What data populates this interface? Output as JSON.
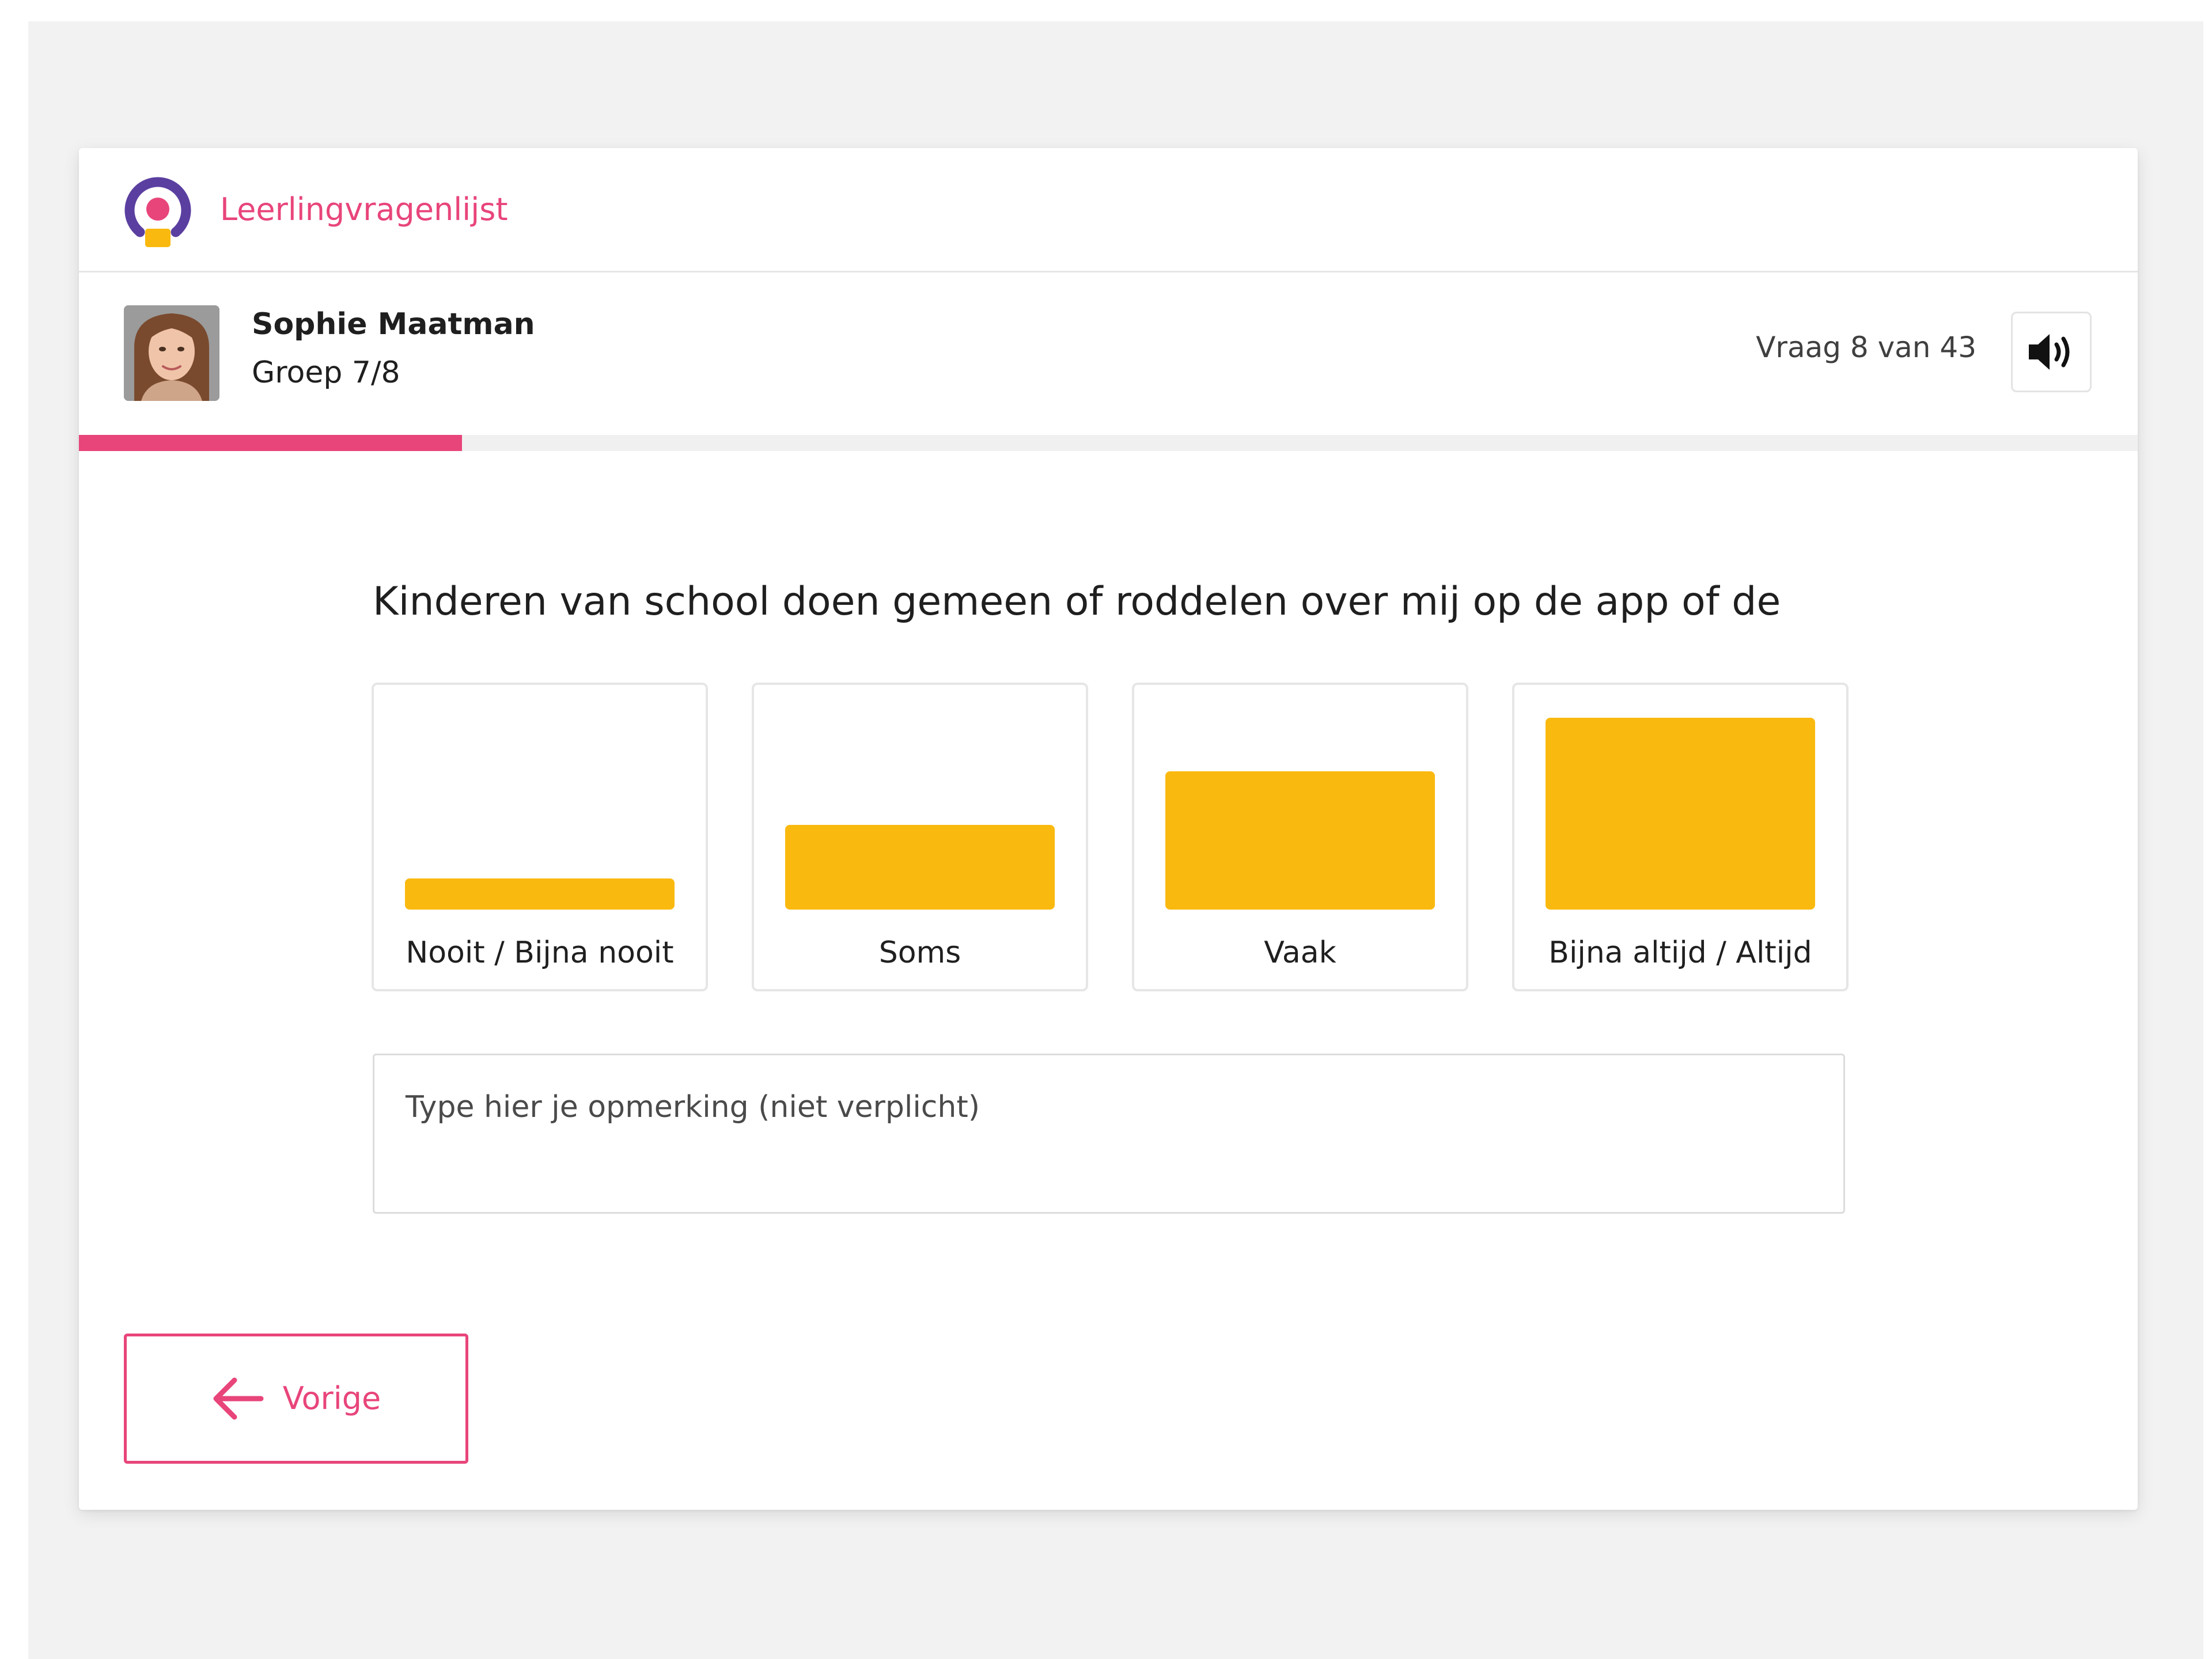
{
  "colors": {
    "accent": "#e8457a",
    "option_fill": "#fab90e",
    "logo_ring": "#5b3fa0",
    "logo_dot": "#e8457a",
    "logo_base": "#fab90e"
  },
  "header": {
    "app_title": "Leerlingvragenlijst",
    "logo_icon": "survey-logo-icon"
  },
  "student": {
    "name": "Sophie Maatman",
    "group": "Groep 7/8",
    "avatar_icon": "student-photo"
  },
  "progress": {
    "counter_text": "Vraag 8 van 43",
    "fraction": 0.186,
    "sound_icon": "speaker-icon"
  },
  "question": {
    "text": "Kinderen van school doen gemeen of roddelen over mij op de app of de"
  },
  "options": [
    {
      "label": "Nooit / Bijna nooit",
      "level": 1
    },
    {
      "label": "Soms",
      "level": 2
    },
    {
      "label": "Vaak",
      "level": 3
    },
    {
      "label": "Bijna altijd / Altijd",
      "level": 4
    }
  ],
  "remark": {
    "placeholder": "Type hier je opmerking (niet verplicht)",
    "value": ""
  },
  "navigation": {
    "previous_label": "Vorige",
    "previous_icon": "arrow-left-icon"
  }
}
